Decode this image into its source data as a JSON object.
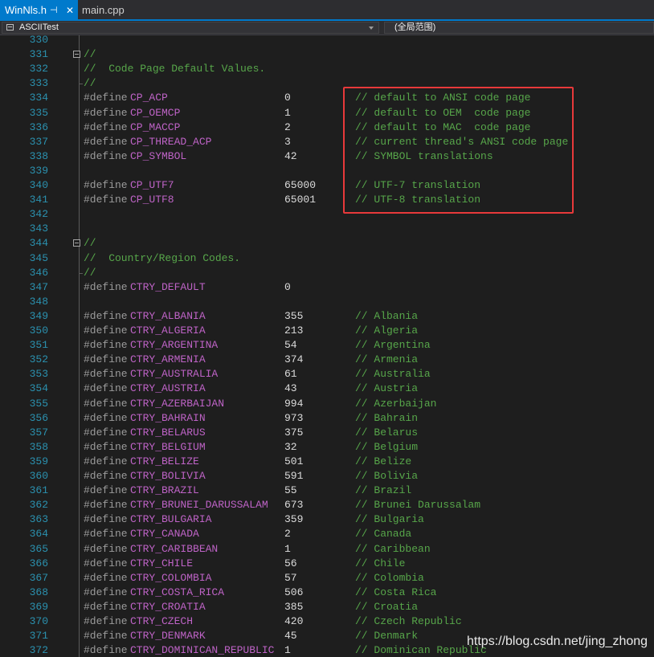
{
  "tabs": [
    {
      "label": "WinNls.h",
      "active": true,
      "pin_icon": "pin-icon",
      "close_icon": "close-icon"
    },
    {
      "label": "main.cpp",
      "active": false
    }
  ],
  "navbar": {
    "scope_label": "ASCIITest",
    "scope_icon": "class-icon",
    "global_scope_label": "(全局范围)"
  },
  "code_lines": [
    {
      "num": "330",
      "kind": "blank"
    },
    {
      "num": "331",
      "kind": "comment",
      "text": "//",
      "fold": true
    },
    {
      "num": "332",
      "kind": "comment",
      "text": "//  Code Page Default Values."
    },
    {
      "num": "333",
      "kind": "comment",
      "text": "//"
    },
    {
      "num": "334",
      "kind": "define",
      "macro": "CP_ACP",
      "value": "0",
      "comment": "// default to ANSI code page"
    },
    {
      "num": "335",
      "kind": "define",
      "macro": "CP_OEMCP",
      "value": "1",
      "comment": "// default to OEM  code page"
    },
    {
      "num": "336",
      "kind": "define",
      "macro": "CP_MACCP",
      "value": "2",
      "comment": "// default to MAC  code page"
    },
    {
      "num": "337",
      "kind": "define",
      "macro": "CP_THREAD_ACP",
      "value": "3",
      "comment": "// current thread's ANSI code page"
    },
    {
      "num": "338",
      "kind": "define",
      "macro": "CP_SYMBOL",
      "value": "42",
      "comment": "// SYMBOL translations"
    },
    {
      "num": "339",
      "kind": "blank"
    },
    {
      "num": "340",
      "kind": "define",
      "macro": "CP_UTF7",
      "value": "65000",
      "comment": "// UTF-7 translation"
    },
    {
      "num": "341",
      "kind": "define",
      "macro": "CP_UTF8",
      "value": "65001",
      "comment": "// UTF-8 translation"
    },
    {
      "num": "342",
      "kind": "blank"
    },
    {
      "num": "343",
      "kind": "blank"
    },
    {
      "num": "344",
      "kind": "comment",
      "text": "//",
      "fold": true
    },
    {
      "num": "345",
      "kind": "comment",
      "text": "//  Country/Region Codes."
    },
    {
      "num": "346",
      "kind": "comment",
      "text": "//"
    },
    {
      "num": "347",
      "kind": "define",
      "macro": "CTRY_DEFAULT",
      "value": "0"
    },
    {
      "num": "348",
      "kind": "blank"
    },
    {
      "num": "349",
      "kind": "define",
      "macro": "CTRY_ALBANIA",
      "value": "355",
      "comment": "// Albania"
    },
    {
      "num": "350",
      "kind": "define",
      "macro": "CTRY_ALGERIA",
      "value": "213",
      "comment": "// Algeria"
    },
    {
      "num": "351",
      "kind": "define",
      "macro": "CTRY_ARGENTINA",
      "value": "54",
      "comment": "// Argentina"
    },
    {
      "num": "352",
      "kind": "define",
      "macro": "CTRY_ARMENIA",
      "value": "374",
      "comment": "// Armenia"
    },
    {
      "num": "353",
      "kind": "define",
      "macro": "CTRY_AUSTRALIA",
      "value": "61",
      "comment": "// Australia"
    },
    {
      "num": "354",
      "kind": "define",
      "macro": "CTRY_AUSTRIA",
      "value": "43",
      "comment": "// Austria"
    },
    {
      "num": "355",
      "kind": "define",
      "macro": "CTRY_AZERBAIJAN",
      "value": "994",
      "comment": "// Azerbaijan"
    },
    {
      "num": "356",
      "kind": "define",
      "macro": "CTRY_BAHRAIN",
      "value": "973",
      "comment": "// Bahrain"
    },
    {
      "num": "357",
      "kind": "define",
      "macro": "CTRY_BELARUS",
      "value": "375",
      "comment": "// Belarus"
    },
    {
      "num": "358",
      "kind": "define",
      "macro": "CTRY_BELGIUM",
      "value": "32",
      "comment": "// Belgium"
    },
    {
      "num": "359",
      "kind": "define",
      "macro": "CTRY_BELIZE",
      "value": "501",
      "comment": "// Belize"
    },
    {
      "num": "360",
      "kind": "define",
      "macro": "CTRY_BOLIVIA",
      "value": "591",
      "comment": "// Bolivia"
    },
    {
      "num": "361",
      "kind": "define",
      "macro": "CTRY_BRAZIL",
      "value": "55",
      "comment": "// Brazil"
    },
    {
      "num": "362",
      "kind": "define",
      "macro": "CTRY_BRUNEI_DARUSSALAM",
      "value": "673",
      "comment": "// Brunei Darussalam"
    },
    {
      "num": "363",
      "kind": "define",
      "macro": "CTRY_BULGARIA",
      "value": "359",
      "comment": "// Bulgaria"
    },
    {
      "num": "364",
      "kind": "define",
      "macro": "CTRY_CANADA",
      "value": "2",
      "comment": "// Canada"
    },
    {
      "num": "365",
      "kind": "define",
      "macro": "CTRY_CARIBBEAN",
      "value": "1",
      "comment": "// Caribbean"
    },
    {
      "num": "366",
      "kind": "define",
      "macro": "CTRY_CHILE",
      "value": "56",
      "comment": "// Chile"
    },
    {
      "num": "367",
      "kind": "define",
      "macro": "CTRY_COLOMBIA",
      "value": "57",
      "comment": "// Colombia"
    },
    {
      "num": "368",
      "kind": "define",
      "macro": "CTRY_COSTA_RICA",
      "value": "506",
      "comment": "// Costa Rica"
    },
    {
      "num": "369",
      "kind": "define",
      "macro": "CTRY_CROATIA",
      "value": "385",
      "comment": "// Croatia"
    },
    {
      "num": "370",
      "kind": "define",
      "macro": "CTRY_CZECH",
      "value": "420",
      "comment": "// Czech Republic"
    },
    {
      "num": "371",
      "kind": "define",
      "macro": "CTRY_DENMARK",
      "value": "45",
      "comment": "// Denmark"
    },
    {
      "num": "372",
      "kind": "define",
      "macro": "CTRY_DOMINICAN_REPUBLIC",
      "value": "1",
      "comment": "// Dominican Republic"
    }
  ],
  "define_keyword": "#define",
  "watermark": "https://blog.csdn.net/jing_zhong",
  "colors": {
    "accent": "#007acc",
    "highlight_box": "#e8393a",
    "line_number": "#2b91af",
    "macro": "#be63c6",
    "comment": "#57a64a",
    "preprocessor": "#9b9b9b"
  }
}
